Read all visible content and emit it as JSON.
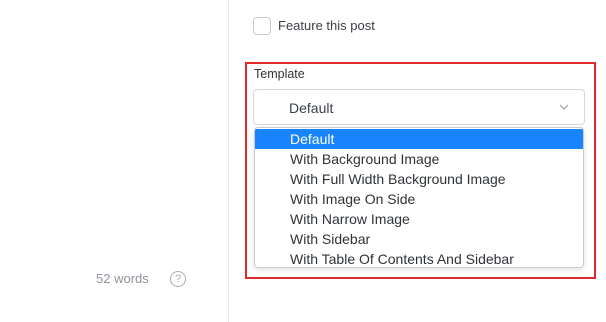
{
  "editor": {
    "word_count": "52 words",
    "help_icon": "?"
  },
  "settings": {
    "feature_post_label": "Feature this post",
    "feature_post_checked": false,
    "template_label": "Template",
    "template_selected": "Default",
    "template_options": [
      "Default",
      "With Background Image",
      "With Full Width Background Image",
      "With Image On Side",
      "With Narrow Image",
      "With Sidebar",
      "With Table Of Contents And Sidebar"
    ]
  },
  "colors": {
    "highlight_border": "#e02a2a",
    "selected_option": "#1a84ff"
  }
}
